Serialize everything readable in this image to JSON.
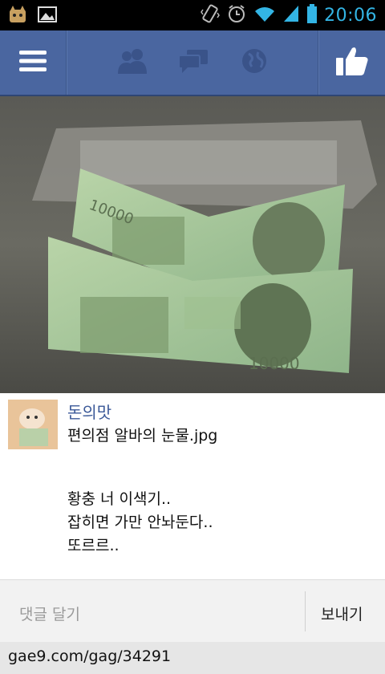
{
  "status_bar": {
    "time": "20:06",
    "icons": [
      "cat-app-icon",
      "gallery-icon",
      "vibrate-icon",
      "alarm-icon",
      "wifi-icon",
      "signal-icon",
      "battery-icon"
    ]
  },
  "nav": {
    "icons": [
      "menu-icon",
      "friends-icon",
      "messages-icon",
      "globe-icon",
      "like-icon"
    ],
    "accent": "#4a66a0"
  },
  "photo": {
    "description_icon": "photo",
    "notes": [
      "10000",
      "10000"
    ]
  },
  "post": {
    "author": "돈의맛",
    "caption": "편의점 알바의 눈물.jpg",
    "lines": [
      "황충 너 이색기..",
      "잡히면 가만 안놔둔다..",
      "또르르.."
    ]
  },
  "comment": {
    "placeholder": "댓글 달기",
    "send_label": "보내기"
  },
  "footer": {
    "url": "gae9.com/gag/34291"
  }
}
